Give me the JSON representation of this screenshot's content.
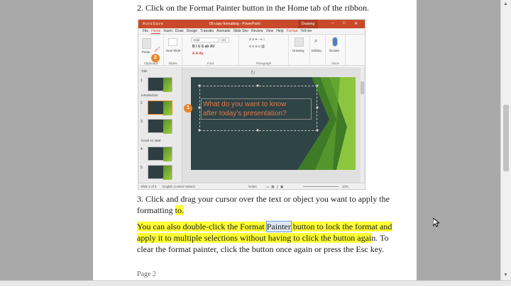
{
  "doc": {
    "step2": "2. Click on the Format Painter button in the Home tab of the ribbon.",
    "step3_line1": "3. Click and drag your cursor over the text or object you want to apply the",
    "step3_line2a": "formatting ",
    "step3_line2b": "to.",
    "tip_l1_a": "You can also double-click the Format ",
    "tip_l1_sel": "Painter",
    "tip_l1_b": " button to lock the format and",
    "tip_l2_a": "apply it to multiple selections without having to click the button agai",
    "tip_l2_b": "n. To",
    "tip_l3": "clear the format painter, click the button once again or press the Esc key.",
    "footer": "Page 2"
  },
  "ppt": {
    "title": "05-copy-formatting - PowerPoint",
    "context_tab": "Drawing",
    "qat": "AutoSave",
    "tabs": [
      "File",
      "Home",
      "Insert",
      "Draw",
      "Design",
      "Transitio",
      "Animatio",
      "Slide Sho",
      "Review",
      "View",
      "Help",
      "Format"
    ],
    "tell_me": "Tell me",
    "groups": {
      "clipboard": "Clipboard",
      "slides": "Slides",
      "font": "Font",
      "paragraph": "Paragraph",
      "voice": "Voice"
    },
    "buttons": {
      "paste": "Paste",
      "new_slide": "New Slide",
      "drawing": "Drawing",
      "editing": "Editing",
      "dictate": "Dictate",
      "font_name": "Arial",
      "font_size": "24"
    },
    "callouts": {
      "c1": "1",
      "c2": "2"
    },
    "sections": {
      "title": "Title",
      "intro": "Introduction",
      "good_bad": "Good vs. Bad"
    },
    "thumb_numbers": [
      "1",
      "2",
      "3",
      "4",
      "5"
    ],
    "slide_text_l1": "What do you want to know",
    "slide_text_l2": "after today's presentation?",
    "status": {
      "slide": "Slide 2 of 8",
      "lang": "English (United States)",
      "notes": "Notes",
      "zoom": "43%"
    }
  },
  "colors": {
    "accent": "#c94a2b",
    "highlight": "#ffff33",
    "callout": "#e8862a",
    "slide_bg": "#2f4446"
  }
}
